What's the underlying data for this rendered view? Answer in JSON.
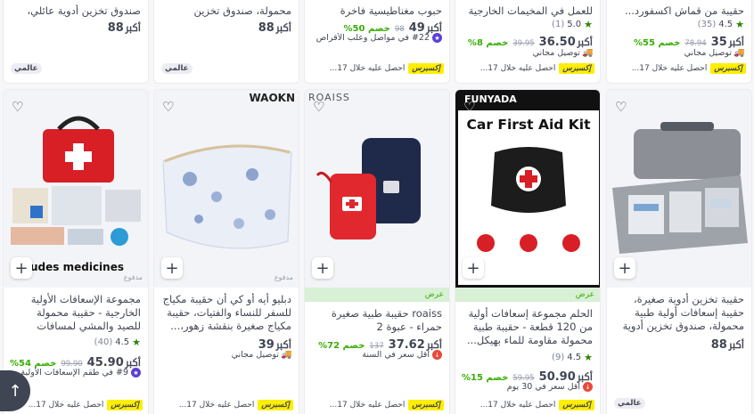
{
  "top_row": [
    {
      "title": "صندوق تخزين أدوية عائلي، حقي...",
      "price": "88",
      "currency": "ﷳ",
      "global_badge": "عالمي"
    },
    {
      "title": "محمولة، صندوق تخزين للأدوية...",
      "price": "88",
      "currency": "ﷳ",
      "global_badge": "عالمي"
    },
    {
      "title": "حبوب مغناطيسية فاخرة صباحًا...",
      "price": "49",
      "currency": "ﷳ",
      "old_price": "98",
      "discount": "خصم 50%",
      "note": "#22 في مواصل وعلب الأقراص",
      "express_badge": "إكسبرس",
      "express_text": "احصل عليه خلال 17..."
    },
    {
      "title": "للعمل في المخيمات الخارجية",
      "rating": "5.0",
      "rating_count": "(1)",
      "price": "36.50",
      "currency": "ﷳ",
      "old_price": "39.95",
      "discount": "خصم 8%",
      "shipping": "توصيل مجاني",
      "express_badge": "إكسبرس",
      "express_text": "احصل عليه خلال 17..."
    },
    {
      "title": "حقيبة من قماش اكسفورد...",
      "rating": "4.5",
      "rating_count": "(35)",
      "price": "35",
      "currency": "ﷳ",
      "old_price": "78.94",
      "discount": "خصم 55%",
      "shipping": "توصيل مجاني",
      "express_badge": "إكسبرس",
      "express_text": "احصل عليه خلال 17..."
    }
  ],
  "bottom_row": [
    {
      "image_text": "udes medicines",
      "sponsored": "مدفوع",
      "title": "مجموعة الإسعافات الأولية الخارجية - حقيبة محمولة للصيد والمشي لمسافات طويلة...",
      "rating": "4.5",
      "rating_count": "(40)",
      "price": "45.90",
      "currency": "ﷳ",
      "old_price": "99.90",
      "discount": "خصم 54%",
      "note": "#9 في طقم الإسعافات الأولية",
      "express_badge": "إكسبرس",
      "express_text": "احصل عليه خلال 17..."
    },
    {
      "image_text": "WAOKN",
      "sponsored": "مدفوع",
      "title": "دبليو أيه أو كي أن حقيبة مكياج للسفر للنساء والفتيات، حقيبة مكياج صغيرة بنقشة زهور،...",
      "price": "39",
      "currency": "ﷳ",
      "shipping": "توصيل مجاني",
      "express_badge": "إكسبرس",
      "express_text": "احصل عليه خلال 17..."
    },
    {
      "image_text": "ROAISS",
      "offer": "عرض",
      "title": "roaiss حقيبة طبية صغيرة حمراء - عبوة 2",
      "price": "37.62",
      "currency": "ﷳ",
      "old_price": "137",
      "discount": "خصم 72%",
      "note": "أقل سعر في السنة",
      "express_badge": "إكسبرس",
      "express_text": "احصل عليه خلال 17..."
    },
    {
      "image_text": "Car First Aid Kit",
      "image_brand": "FUNYADA",
      "offer": "عرض",
      "title": "الحلم مجموعة إسعافات أولية من 120 قطعة - حقيبة طبية محمولة مقاومة للماء بهيكل...",
      "rating": "4.5",
      "rating_count": "(9)",
      "price": "50.90",
      "currency": "ﷳ",
      "old_price": "59.95",
      "discount": "خصم 15%",
      "note": "أقل سعر في 30 يوم",
      "express_badge": "إكسبرس",
      "express_text": "احصل عليه خلال 17..."
    },
    {
      "title": "حقيبة تخزين أدوية صغيرة، حقيبة إسعافات أولية طبية محمولة، صندوق تخزين أدوية عائلي، حقي...",
      "price": "88",
      "currency": "ﷳ",
      "global_badge": "عالمي"
    }
  ],
  "colors": {
    "express_yellow": "#feee00",
    "discount_green": "#38ae04",
    "star_green": "#2a8703",
    "offer_bg": "#d8f0d5"
  }
}
